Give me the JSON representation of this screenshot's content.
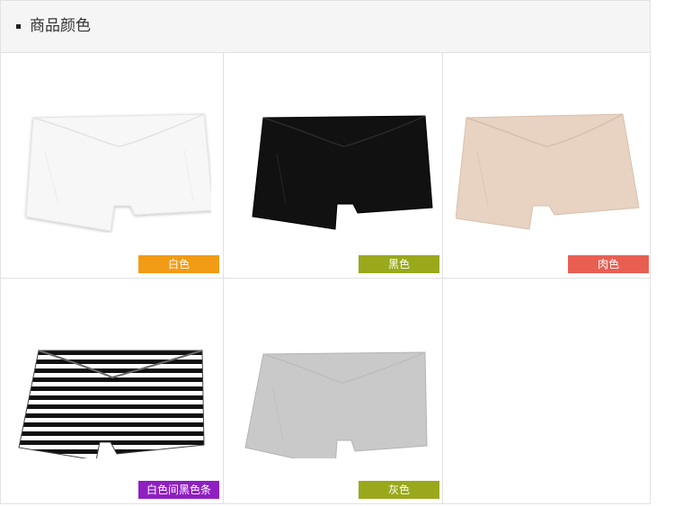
{
  "section": {
    "title": "商品颜色",
    "bullet_icon": "square-bullet-icon"
  },
  "colors": [
    {
      "name": "白色",
      "tag_color": "#f29b14",
      "shorts_fill": "#f7f7f7",
      "pattern": "solid",
      "icon": "white-shorts-image"
    },
    {
      "name": "黑色",
      "tag_color": "#9aa81c",
      "shorts_fill": "#111111",
      "pattern": "solid",
      "icon": "black-shorts-image"
    },
    {
      "name": "肉色",
      "tag_color": "#e85f52",
      "shorts_fill": "#e8d2c2",
      "pattern": "solid",
      "icon": "nude-shorts-image"
    },
    {
      "name": "白色间黑色条",
      "tag_color": "#8e1fc0",
      "shorts_fill": "#ffffff",
      "pattern": "stripes",
      "icon": "striped-shorts-image"
    },
    {
      "name": "灰色",
      "tag_color": "#9aa81c",
      "shorts_fill": "#c9c9c9",
      "pattern": "solid",
      "icon": "gray-shorts-image"
    }
  ]
}
